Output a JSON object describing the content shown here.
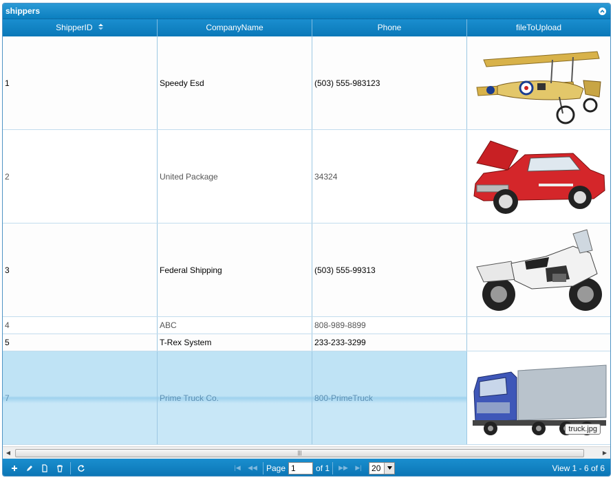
{
  "grid": {
    "caption": "shippers",
    "columns": [
      {
        "label": "ShipperID",
        "sorted": "asc"
      },
      {
        "label": "CompanyName"
      },
      {
        "label": "Phone"
      },
      {
        "label": "fileToUpload"
      }
    ],
    "rows": [
      {
        "id": "1",
        "company": "Speedy Esd",
        "phone": "(503) 555-983123",
        "image": "biplane-image"
      },
      {
        "id": "2",
        "company": "United Package",
        "phone": "34324",
        "image": "red-car-image"
      },
      {
        "id": "3",
        "company": "Federal Shipping",
        "phone": "(503) 555-99313",
        "image": "motorcycle-image"
      },
      {
        "id": "4",
        "company": "ABC",
        "phone": "808-989-8899",
        "image": ""
      },
      {
        "id": "5",
        "company": "T-Rex System",
        "phone": "233-233-3299",
        "image": ""
      },
      {
        "id": "7",
        "company": "Prime Truck Co.",
        "phone": "800-PrimeTruck",
        "image": "truck-image",
        "selected": true
      }
    ],
    "tooltip": "truck.jpg"
  },
  "pager": {
    "page_label": "Page",
    "page_value": "1",
    "of_label": "of 1",
    "rows_per_page": "20",
    "view_text": "View 1 - 6 of 6"
  },
  "colors": {
    "header": "#0a78b8",
    "selected_row": "#bfe3f5",
    "border": "#9cc8e3"
  }
}
